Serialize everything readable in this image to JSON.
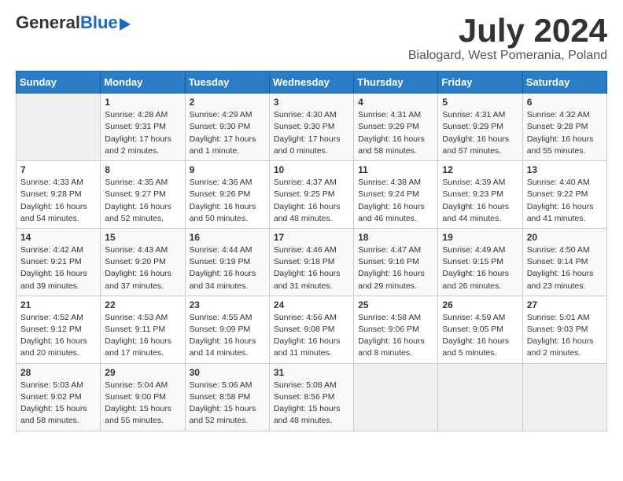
{
  "header": {
    "logo_general": "General",
    "logo_blue": "Blue",
    "month_year": "July 2024",
    "location": "Bialogard, West Pomerania, Poland"
  },
  "days_of_week": [
    "Sunday",
    "Monday",
    "Tuesday",
    "Wednesday",
    "Thursday",
    "Friday",
    "Saturday"
  ],
  "weeks": [
    [
      {
        "day": "",
        "info": ""
      },
      {
        "day": "1",
        "info": "Sunrise: 4:28 AM\nSunset: 9:31 PM\nDaylight: 17 hours\nand 2 minutes."
      },
      {
        "day": "2",
        "info": "Sunrise: 4:29 AM\nSunset: 9:30 PM\nDaylight: 17 hours\nand 1 minute."
      },
      {
        "day": "3",
        "info": "Sunrise: 4:30 AM\nSunset: 9:30 PM\nDaylight: 17 hours\nand 0 minutes."
      },
      {
        "day": "4",
        "info": "Sunrise: 4:31 AM\nSunset: 9:29 PM\nDaylight: 16 hours\nand 58 minutes."
      },
      {
        "day": "5",
        "info": "Sunrise: 4:31 AM\nSunset: 9:29 PM\nDaylight: 16 hours\nand 57 minutes."
      },
      {
        "day": "6",
        "info": "Sunrise: 4:32 AM\nSunset: 9:28 PM\nDaylight: 16 hours\nand 55 minutes."
      }
    ],
    [
      {
        "day": "7",
        "info": "Sunrise: 4:33 AM\nSunset: 9:28 PM\nDaylight: 16 hours\nand 54 minutes."
      },
      {
        "day": "8",
        "info": "Sunrise: 4:35 AM\nSunset: 9:27 PM\nDaylight: 16 hours\nand 52 minutes."
      },
      {
        "day": "9",
        "info": "Sunrise: 4:36 AM\nSunset: 9:26 PM\nDaylight: 16 hours\nand 50 minutes."
      },
      {
        "day": "10",
        "info": "Sunrise: 4:37 AM\nSunset: 9:25 PM\nDaylight: 16 hours\nand 48 minutes."
      },
      {
        "day": "11",
        "info": "Sunrise: 4:38 AM\nSunset: 9:24 PM\nDaylight: 16 hours\nand 46 minutes."
      },
      {
        "day": "12",
        "info": "Sunrise: 4:39 AM\nSunset: 9:23 PM\nDaylight: 16 hours\nand 44 minutes."
      },
      {
        "day": "13",
        "info": "Sunrise: 4:40 AM\nSunset: 9:22 PM\nDaylight: 16 hours\nand 41 minutes."
      }
    ],
    [
      {
        "day": "14",
        "info": "Sunrise: 4:42 AM\nSunset: 9:21 PM\nDaylight: 16 hours\nand 39 minutes."
      },
      {
        "day": "15",
        "info": "Sunrise: 4:43 AM\nSunset: 9:20 PM\nDaylight: 16 hours\nand 37 minutes."
      },
      {
        "day": "16",
        "info": "Sunrise: 4:44 AM\nSunset: 9:19 PM\nDaylight: 16 hours\nand 34 minutes."
      },
      {
        "day": "17",
        "info": "Sunrise: 4:46 AM\nSunset: 9:18 PM\nDaylight: 16 hours\nand 31 minutes."
      },
      {
        "day": "18",
        "info": "Sunrise: 4:47 AM\nSunset: 9:16 PM\nDaylight: 16 hours\nand 29 minutes."
      },
      {
        "day": "19",
        "info": "Sunrise: 4:49 AM\nSunset: 9:15 PM\nDaylight: 16 hours\nand 26 minutes."
      },
      {
        "day": "20",
        "info": "Sunrise: 4:50 AM\nSunset: 9:14 PM\nDaylight: 16 hours\nand 23 minutes."
      }
    ],
    [
      {
        "day": "21",
        "info": "Sunrise: 4:52 AM\nSunset: 9:12 PM\nDaylight: 16 hours\nand 20 minutes."
      },
      {
        "day": "22",
        "info": "Sunrise: 4:53 AM\nSunset: 9:11 PM\nDaylight: 16 hours\nand 17 minutes."
      },
      {
        "day": "23",
        "info": "Sunrise: 4:55 AM\nSunset: 9:09 PM\nDaylight: 16 hours\nand 14 minutes."
      },
      {
        "day": "24",
        "info": "Sunrise: 4:56 AM\nSunset: 9:08 PM\nDaylight: 16 hours\nand 11 minutes."
      },
      {
        "day": "25",
        "info": "Sunrise: 4:58 AM\nSunset: 9:06 PM\nDaylight: 16 hours\nand 8 minutes."
      },
      {
        "day": "26",
        "info": "Sunrise: 4:59 AM\nSunset: 9:05 PM\nDaylight: 16 hours\nand 5 minutes."
      },
      {
        "day": "27",
        "info": "Sunrise: 5:01 AM\nSunset: 9:03 PM\nDaylight: 16 hours\nand 2 minutes."
      }
    ],
    [
      {
        "day": "28",
        "info": "Sunrise: 5:03 AM\nSunset: 9:02 PM\nDaylight: 15 hours\nand 58 minutes."
      },
      {
        "day": "29",
        "info": "Sunrise: 5:04 AM\nSunset: 9:00 PM\nDaylight: 15 hours\nand 55 minutes."
      },
      {
        "day": "30",
        "info": "Sunrise: 5:06 AM\nSunset: 8:58 PM\nDaylight: 15 hours\nand 52 minutes."
      },
      {
        "day": "31",
        "info": "Sunrise: 5:08 AM\nSunset: 8:56 PM\nDaylight: 15 hours\nand 48 minutes."
      },
      {
        "day": "",
        "info": ""
      },
      {
        "day": "",
        "info": ""
      },
      {
        "day": "",
        "info": ""
      }
    ]
  ]
}
